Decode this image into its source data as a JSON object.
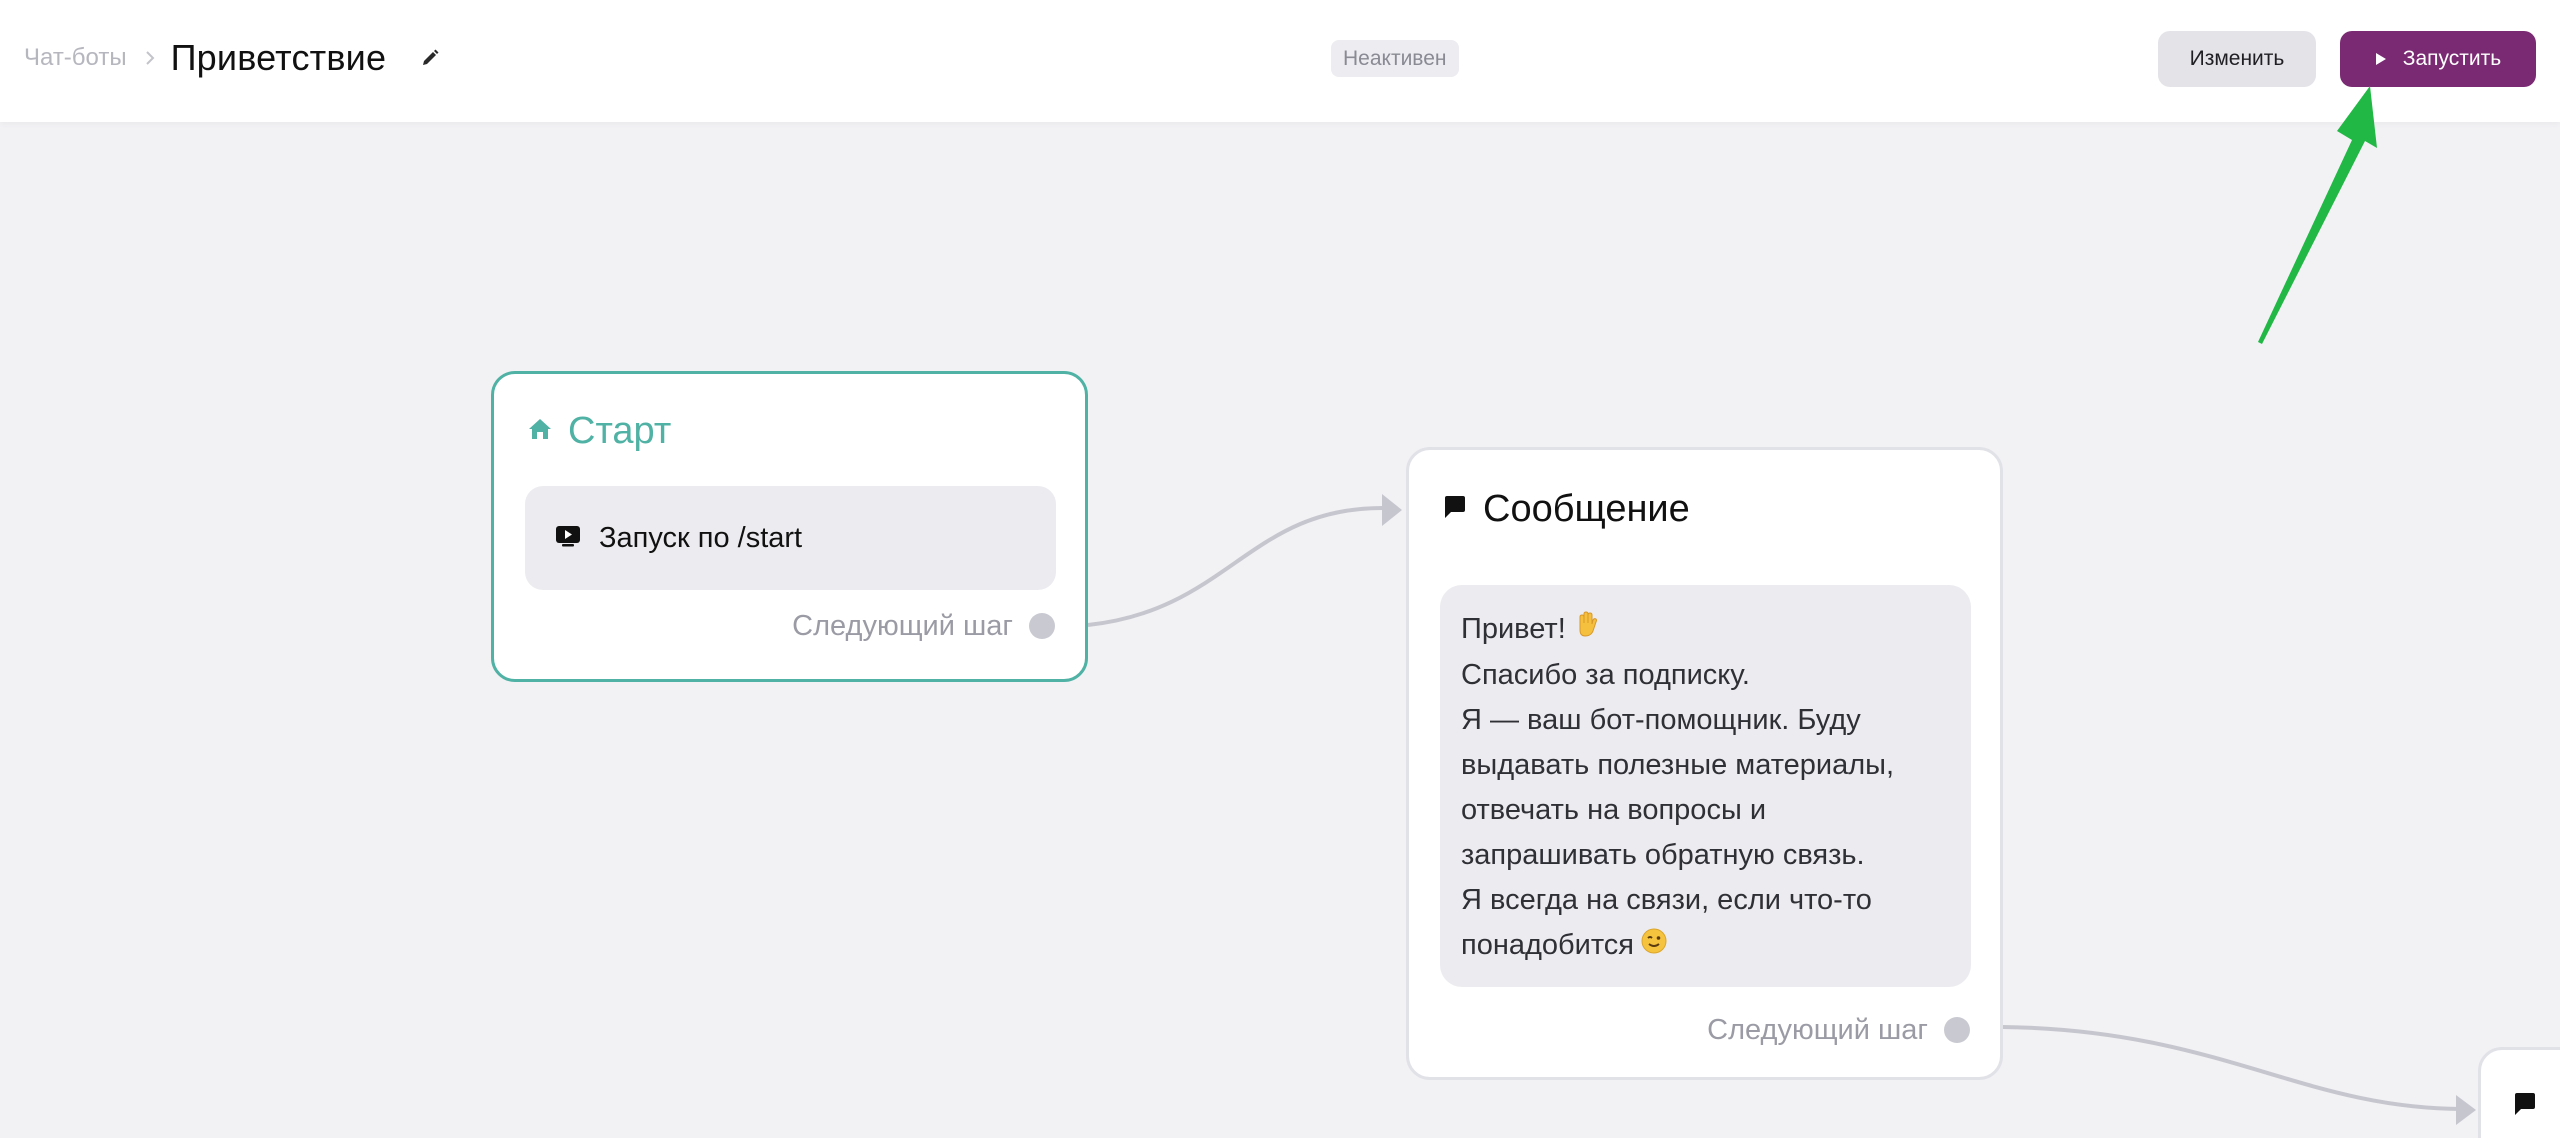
{
  "header": {
    "breadcrumb_parent": "Чат-боты",
    "title": "Приветствие",
    "status": "Неактивен",
    "edit_button": "Изменить",
    "run_button": "Запустить"
  },
  "nodes": {
    "start": {
      "title": "Старт",
      "trigger": "Запуск по /start",
      "next_step": "Следующий шаг"
    },
    "message": {
      "title": "Сообщение",
      "lines": [
        "Привет!",
        "Спасибо за подписку.",
        "Я — ваш бот-помощник. Буду",
        "выдавать полезные материалы,",
        "отвечать на вопросы и",
        "запрашивать обратную связь.",
        "Я всегда на связи, если что-то",
        "понадобится"
      ],
      "next_step": "Следующий шаг"
    }
  },
  "icons": {
    "edit": "pencil-icon",
    "run": "play-icon",
    "start": "home-icon",
    "trigger": "youtube-play-icon",
    "message": "chat-bubble-icon",
    "annotation": "green-arrow"
  },
  "colors": {
    "accent": "#7a2a72",
    "start_border": "#4fb2a4",
    "canvas": "#f2f2f5",
    "connector": "#c6c6ce",
    "annotation": "#22b845"
  }
}
